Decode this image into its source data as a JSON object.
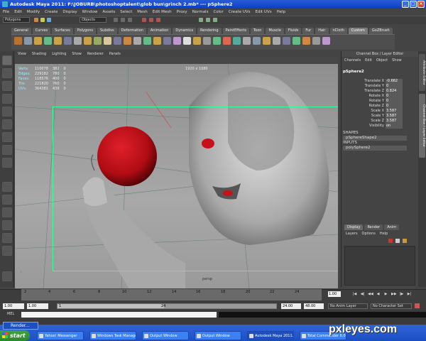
{
  "window": {
    "title": "Autodesk Maya 2011: F:\\JOBURB\\photoshoptalent\\glob bun\\grinch 2.mb*    ---    pSphere2"
  },
  "menubar": [
    "File",
    "Edit",
    "Modify",
    "Create",
    "Display",
    "Window",
    "Assets",
    "Select",
    "Mesh",
    "Edit Mesh",
    "Proxy",
    "Normals",
    "Color",
    "Create UVs",
    "Edit UVs",
    "Help"
  ],
  "status": {
    "menu_set": "Polygons",
    "selection_field": "Objects"
  },
  "shelf_tabs": [
    "General",
    "Curves",
    "Surfaces",
    "Polygons",
    "Subdivs",
    "Deformation",
    "Animation",
    "Dynamics",
    "Rendering",
    "PaintEffects",
    "Toon",
    "Muscle",
    "Fluids",
    "Fur",
    "Hair",
    "nCloth",
    "Custom",
    "GoZBrush"
  ],
  "shelf_active": "Custom",
  "viewport": {
    "menu": [
      "View",
      "Shading",
      "Lighting",
      "Show",
      "Renderer",
      "Panels"
    ],
    "stats": [
      {
        "label": "Verts:",
        "a": "110078",
        "b": "382",
        "c": "0"
      },
      {
        "label": "Edges:",
        "a": "229182",
        "b": "780",
        "c": "0"
      },
      {
        "label": "Faces:",
        "a": "118576",
        "b": "400",
        "c": "0"
      },
      {
        "label": "Tris:",
        "a": "221820",
        "b": "760",
        "c": "0"
      },
      {
        "label": "UVs:",
        "a": "364381",
        "b": "439",
        "c": "0"
      }
    ],
    "resolution": "1920 x 1080",
    "camera": "persp"
  },
  "channel_box": {
    "title": "Channel Box / Layer Editor",
    "menu": [
      "Channels",
      "Edit",
      "Object",
      "Show"
    ],
    "object": "pSphere2",
    "attributes": [
      {
        "name": "Translate X",
        "value": "-0.662"
      },
      {
        "name": "Translate Y",
        "value": "0"
      },
      {
        "name": "Translate Z",
        "value": "0.824"
      },
      {
        "name": "Rotate X",
        "value": "0"
      },
      {
        "name": "Rotate Y",
        "value": "0"
      },
      {
        "name": "Rotate Z",
        "value": "0"
      },
      {
        "name": "Scale X",
        "value": "3.587"
      },
      {
        "name": "Scale Y",
        "value": "3.587"
      },
      {
        "name": "Scale Z",
        "value": "3.587"
      },
      {
        "name": "Visibility",
        "value": "on"
      }
    ],
    "shapes_header": "SHAPES",
    "shape": "pSphereShape2",
    "inputs_header": "INPUTS",
    "input": "polySphere2",
    "layer_tabs": [
      "Display",
      "Render",
      "Anim"
    ],
    "layer_menu": [
      "Layers",
      "Options",
      "Help"
    ]
  },
  "side_tabs": [
    "Attribute Editor",
    "Channel Box / Layer Editor"
  ],
  "timeline": {
    "ticks": [
      "2",
      "4",
      "6",
      "8",
      "10",
      "12",
      "14",
      "16",
      "18",
      "20",
      "22",
      "24"
    ],
    "current_frame": "1.00"
  },
  "range": {
    "start": "1.00",
    "inner_start": "1.00",
    "bar_start": "1",
    "bar_end": "24",
    "end": "24.00",
    "anim_end": "48.00",
    "anim_layer": "No Anim Layer",
    "character": "No Character Set"
  },
  "cmdline": {
    "label": "MEL"
  },
  "taskbar": {
    "start": "start",
    "render_tip": "Render...",
    "tasks": [
      {
        "label": "Yahoo! Messenger",
        "active": false
      },
      {
        "label": "Windows Task Manager",
        "active": false
      },
      {
        "label": "Output Window",
        "active": false
      },
      {
        "label": "Output Window",
        "active": false
      },
      {
        "label": "Autodesk Maya 2011...",
        "active": true
      },
      {
        "label": "Total Commander 6.0...",
        "active": false
      }
    ]
  },
  "watermark": "pxleyes.com",
  "colors": {
    "sphere": "#c01018",
    "gate": "#33ff99",
    "title": "#0a3ec2",
    "taskbar": "#2458d2"
  }
}
